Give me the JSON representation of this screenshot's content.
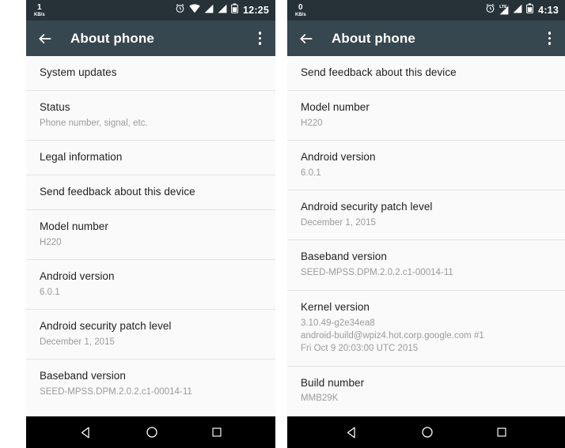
{
  "panels": [
    {
      "status": {
        "net_speed_value": "1",
        "net_speed_unit": "KB/s",
        "icons": [
          "alarm-icon",
          "wifi-icon",
          "signal-icon",
          "signal-icon",
          "battery-icon"
        ],
        "signal_label": "",
        "clock": "12:25"
      },
      "toolbar": {
        "back": "back-arrow-icon",
        "title": "About phone",
        "overflow": "overflow-menu-icon"
      },
      "rows": [
        {
          "title": "System updates",
          "sub": []
        },
        {
          "title": "Status",
          "sub": [
            "Phone number, signal, etc."
          ]
        },
        {
          "title": "Legal information",
          "sub": []
        },
        {
          "title": "Send feedback about this device",
          "sub": []
        },
        {
          "title": "Model number",
          "sub": [
            "H220"
          ]
        },
        {
          "title": "Android version",
          "sub": [
            "6.0.1"
          ]
        },
        {
          "title": "Android security patch level",
          "sub": [
            "December 1, 2015"
          ]
        },
        {
          "title": "Baseband version",
          "sub": [
            "SEED-MPSS.DPM.2.0.2.c1-00014-11"
          ]
        }
      ],
      "nav": {
        "back": "nav-back-icon",
        "home": "nav-home-icon",
        "recents": "nav-recents-icon"
      }
    },
    {
      "status": {
        "net_speed_value": "0",
        "net_speed_unit": "KB/s",
        "icons": [
          "alarm-icon",
          "lte-signal-icon",
          "signal-icon",
          "battery-icon"
        ],
        "signal_label": "LTE",
        "clock": "4:13"
      },
      "toolbar": {
        "back": "back-arrow-icon",
        "title": "About phone",
        "overflow": "overflow-menu-icon"
      },
      "rows": [
        {
          "title": "Send feedback about this device",
          "sub": []
        },
        {
          "title": "Model number",
          "sub": [
            "H220"
          ]
        },
        {
          "title": "Android version",
          "sub": [
            "6.0.1"
          ]
        },
        {
          "title": "Android security patch level",
          "sub": [
            "December 1, 2015"
          ]
        },
        {
          "title": "Baseband version",
          "sub": [
            "SEED-MPSS.DPM.2.0.2.c1-00014-11"
          ]
        },
        {
          "title": "Kernel version",
          "sub": [
            "3.10.49-g2e34ea8",
            "android-build@wpiz4.hot.corp.google.com #1",
            "Fri Oct 9 20:03:00 UTC 2015"
          ]
        },
        {
          "title": "Build number",
          "sub": [
            "MMB29K"
          ]
        }
      ],
      "nav": {
        "back": "nav-back-icon",
        "home": "nav-home-icon",
        "recents": "nav-recents-icon"
      }
    }
  ],
  "colors": {
    "status_bar": "#263238",
    "toolbar": "#37474F",
    "list_background": "#fafafa",
    "divider": "#e4e4e4",
    "primary_text": "#1f1f1f",
    "secondary_text": "#9a9a9a",
    "nav_bar": "#000000"
  }
}
